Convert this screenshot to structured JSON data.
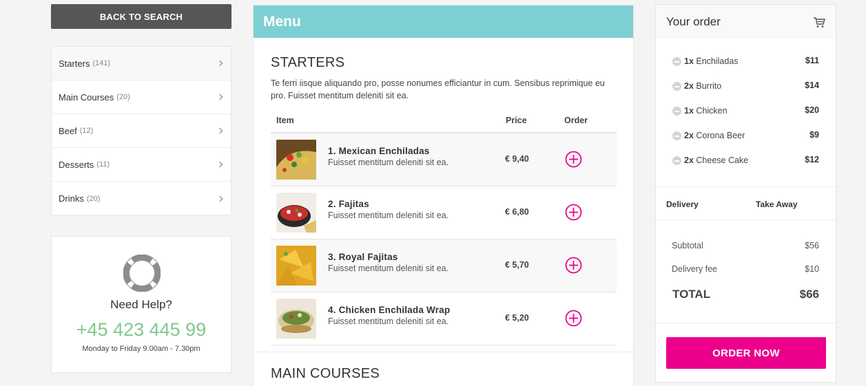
{
  "sidebar": {
    "back_label": "BACK TO SEARCH",
    "categories": [
      {
        "name": "Starters",
        "count": "(141)"
      },
      {
        "name": "Main Courses",
        "count": "(20)"
      },
      {
        "name": "Beef",
        "count": "(12)"
      },
      {
        "name": "Desserts",
        "count": "(11)"
      },
      {
        "name": "Drinks",
        "count": "(20)"
      }
    ],
    "help": {
      "title": "Need Help?",
      "phone": "+45 423 445 99",
      "hours": "Monday to Friday 9.00am - 7.30pm"
    }
  },
  "menu": {
    "header": "Menu",
    "section_title": "STARTERS",
    "section_desc": "Te ferri iisque aliquando pro, posse nonumes efficiantur in cum. Sensibus reprimique eu pro. Fuisset mentitum deleniti sit ea.",
    "columns": {
      "item": "Item",
      "price": "Price",
      "order": "Order"
    },
    "items": [
      {
        "name": "1. Mexican Enchiladas",
        "desc": "Fuisset mentitum deleniti sit ea.",
        "price": "€ 9,40"
      },
      {
        "name": "2. Fajitas",
        "desc": "Fuisset mentitum deleniti sit ea.",
        "price": "€ 6,80"
      },
      {
        "name": "3. Royal Fajitas",
        "desc": "Fuisset mentitum deleniti sit ea.",
        "price": "€ 5,70"
      },
      {
        "name": "4. Chicken Enchilada Wrap",
        "desc": "Fuisset mentitum deleniti sit ea.",
        "price": "€ 5,20"
      }
    ],
    "next_section_title": "MAIN COURSES"
  },
  "order": {
    "title": "Your order",
    "items": [
      {
        "qty": "1x",
        "name": "Enchiladas",
        "price": "$11"
      },
      {
        "qty": "2x",
        "name": "Burrito",
        "price": "$14"
      },
      {
        "qty": "1x",
        "name": "Chicken",
        "price": "$20"
      },
      {
        "qty": "2x",
        "name": "Corona Beer",
        "price": "$9"
      },
      {
        "qty": "2x",
        "name": "Cheese Cake",
        "price": "$12"
      }
    ],
    "delivery_label": "Delivery",
    "takeaway_label": "Take Away",
    "subtotal_label": "Subtotal",
    "subtotal_value": "$56",
    "fee_label": "Delivery fee",
    "fee_value": "$10",
    "total_label": "TOTAL",
    "total_value": "$66",
    "order_button": "ORDER NOW"
  },
  "colors": {
    "menu_header": "#7dd0d2",
    "accent": "#ec008c",
    "phone": "#7fc88f",
    "back_button": "#565656"
  }
}
